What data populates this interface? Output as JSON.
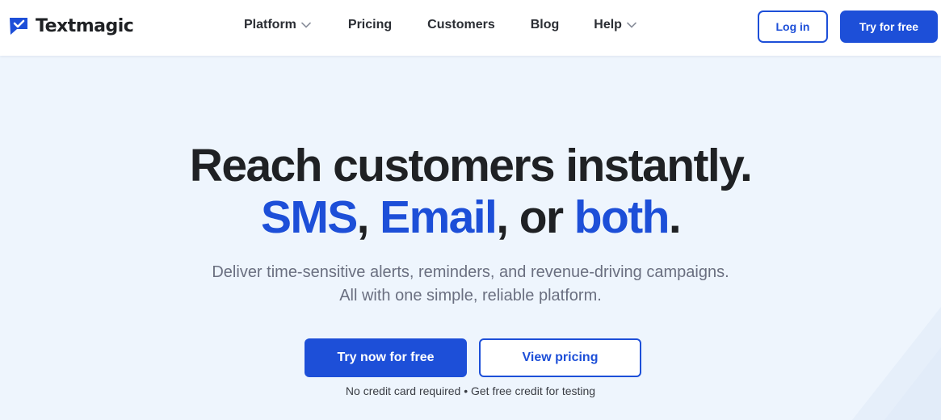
{
  "header": {
    "brand": "Textmagic",
    "nav": [
      {
        "label": "Platform",
        "has_dropdown": true
      },
      {
        "label": "Pricing",
        "has_dropdown": false
      },
      {
        "label": "Customers",
        "has_dropdown": false
      },
      {
        "label": "Blog",
        "has_dropdown": false
      },
      {
        "label": "Help",
        "has_dropdown": true
      }
    ],
    "login_label": "Log in",
    "try_label": "Try for free"
  },
  "hero": {
    "title_line1": "Reach customers instantly.",
    "sms": "SMS",
    "comma1": ",",
    "email": "Email",
    "comma_or": ", or",
    "both": "both",
    "period": ".",
    "sub_line1": "Deliver time-sensitive alerts, reminders, and revenue-driving campaigns.",
    "sub_line2": "All with one simple, reliable platform.",
    "primary_cta": "Try now for free",
    "secondary_cta": "View pricing",
    "note": "No credit card required • Get free credit for testing"
  },
  "colors": {
    "accent": "#1d4fd8",
    "background": "#eef5fd",
    "text": "#1f2124",
    "muted": "#6a6f80"
  },
  "icons": {
    "logo": "chat-bubble-check-icon",
    "dropdown": "chevron-down-icon"
  }
}
